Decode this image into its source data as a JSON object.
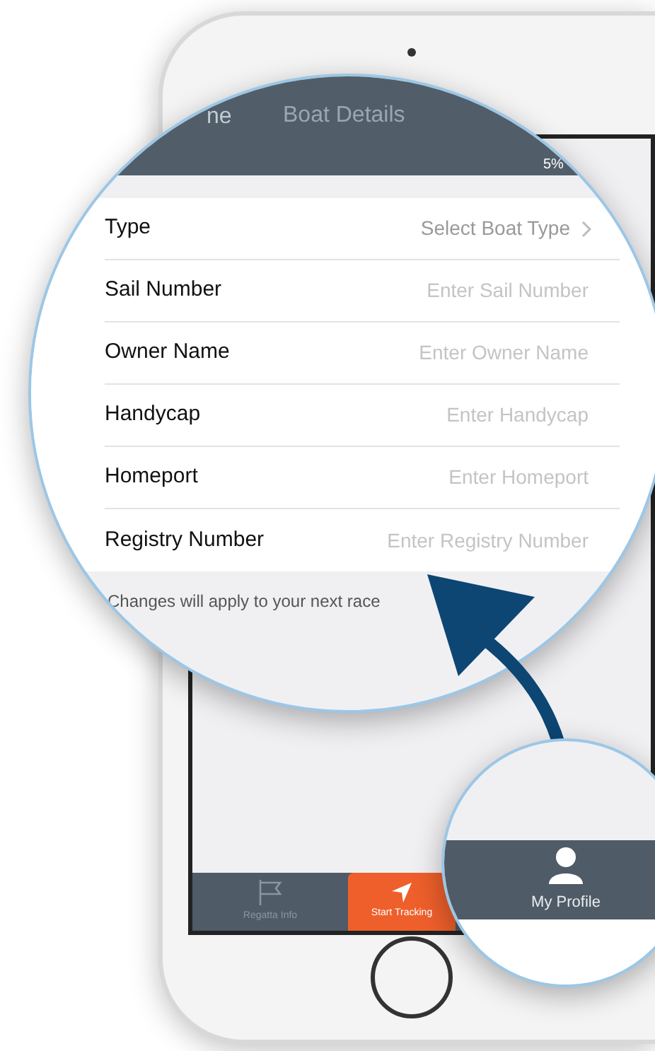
{
  "nav": {
    "back": "ne",
    "title": "Boat Details"
  },
  "status": {
    "battery": "5%"
  },
  "fields": [
    {
      "label": "Type",
      "kind": "select",
      "value": "Select Boat Type"
    },
    {
      "label": "Sail Number",
      "kind": "text",
      "placeholder": "Enter Sail Number"
    },
    {
      "label": "Owner Name",
      "kind": "text",
      "placeholder": "Enter Owner Name"
    },
    {
      "label": "Handycap",
      "kind": "text",
      "placeholder": "Enter Handycap"
    },
    {
      "label": "Homeport",
      "kind": "text",
      "placeholder": "Enter Homeport"
    },
    {
      "label": "Registry Number",
      "kind": "text",
      "placeholder": "Enter Registry Number"
    }
  ],
  "footer": "Changes will apply to your next race",
  "tabs": [
    {
      "label": "Regatta Info",
      "selected": false
    },
    {
      "label": "Start Tracking",
      "selected": true
    },
    {
      "label": "My Profile",
      "selected": false
    }
  ]
}
